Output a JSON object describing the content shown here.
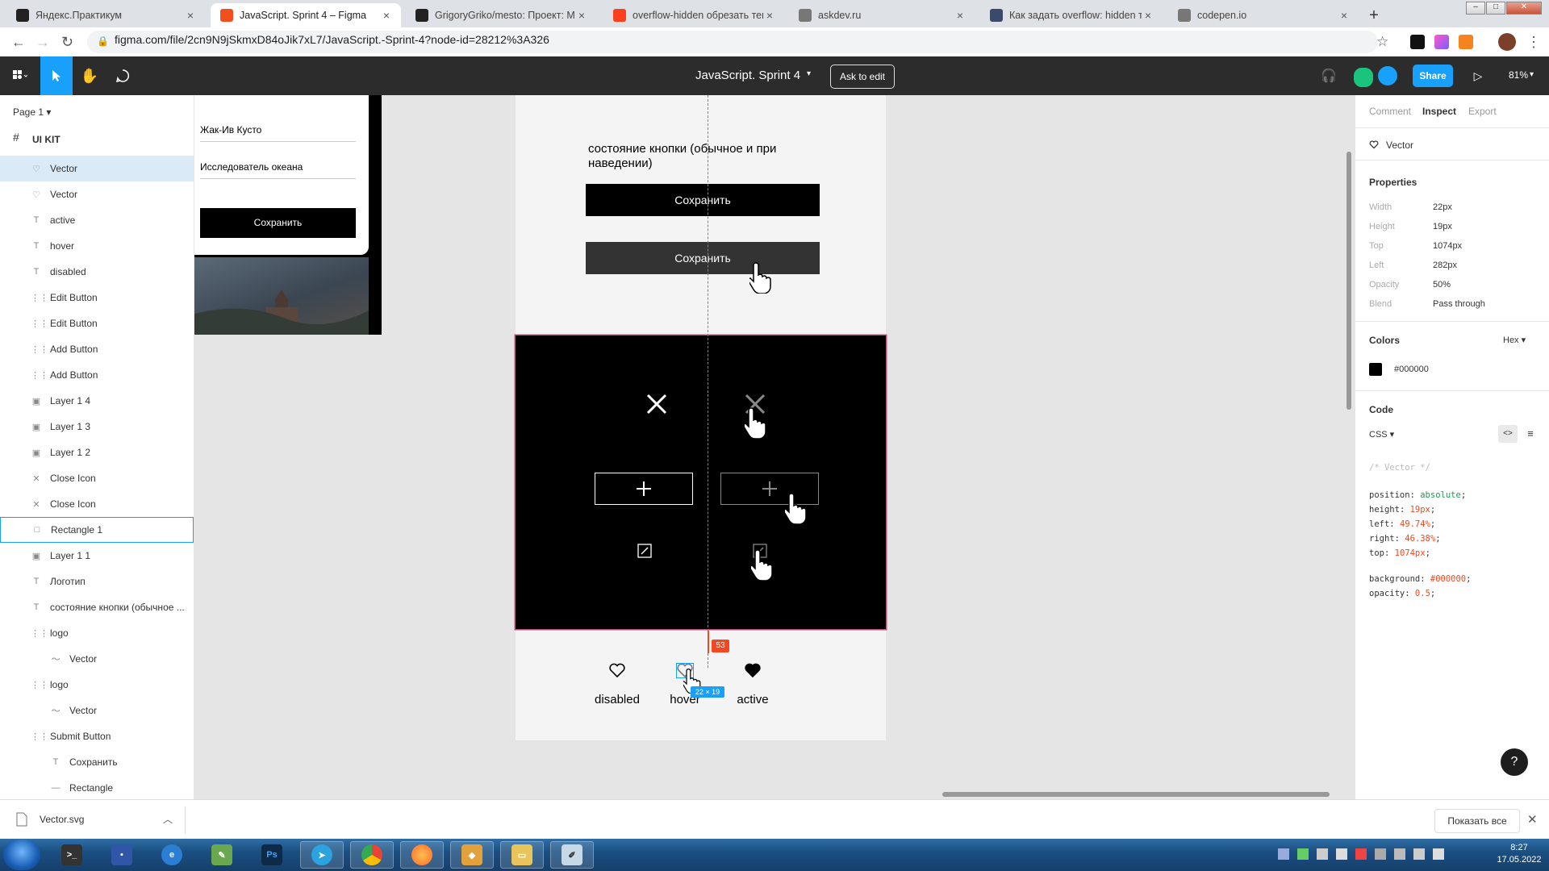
{
  "browser": {
    "tabs": [
      {
        "title": "Яндекс.Практикум",
        "favicon_color": "#222222"
      },
      {
        "title": "JavaScript. Sprint 4 – Figma",
        "favicon_color": "#f24e1e",
        "active": true
      },
      {
        "title": "GrigoryGriko/mesto: Проект: Ме",
        "favicon_color": "#222222"
      },
      {
        "title": "overflow-hidden обрезать текст",
        "favicon_color": "#fc3f1d"
      },
      {
        "title": "askdev.ru",
        "favicon_color": "#777777"
      },
      {
        "title": "Как задать overflow: hidden тол",
        "favicon_color": "#3b4a6b"
      },
      {
        "title": "codepen.io",
        "favicon_color": "#777777"
      }
    ],
    "url": "figma.com/file/2cn9N9jSkmxD84oJik7xL7/JavaScript.-Sprint-4?node-id=28212%3A326"
  },
  "figma": {
    "doc_title": "JavaScript. Sprint 4",
    "ask_to_edit": "Ask to edit",
    "share": "Share",
    "zoom": "81%"
  },
  "layers_panel": {
    "page": "Page 1",
    "frame": "UI KIT",
    "items": [
      {
        "name": "Vector",
        "icon": "heart-icon",
        "selected": true
      },
      {
        "name": "Vector",
        "icon": "heart-icon"
      },
      {
        "name": "active",
        "icon": "text-icon"
      },
      {
        "name": "hover",
        "icon": "text-icon"
      },
      {
        "name": "disabled",
        "icon": "text-icon"
      },
      {
        "name": "Edit Button",
        "icon": "group-icon"
      },
      {
        "name": "Edit Button",
        "icon": "group-icon"
      },
      {
        "name": "Add Button",
        "icon": "group-icon"
      },
      {
        "name": "Add Button",
        "icon": "group-icon"
      },
      {
        "name": "Layer 1 4",
        "icon": "image-icon"
      },
      {
        "name": "Layer 1 3",
        "icon": "image-icon"
      },
      {
        "name": "Layer 1 2",
        "icon": "image-icon"
      },
      {
        "name": "Close Icon",
        "icon": "close-icon"
      },
      {
        "name": "Close Icon",
        "icon": "close-icon"
      },
      {
        "name": "Rectangle 1",
        "icon": "rectangle-icon",
        "outlined": true
      },
      {
        "name": "Layer 1 1",
        "icon": "image-icon"
      },
      {
        "name": "Логотип",
        "icon": "text-icon"
      },
      {
        "name": "состояние кнопки (обычное ...",
        "icon": "text-icon"
      },
      {
        "name": "logo",
        "icon": "group-icon"
      },
      {
        "name": "Vector",
        "icon": "vector-icon",
        "indent": true
      },
      {
        "name": "logo",
        "icon": "group-icon"
      },
      {
        "name": "Vector",
        "icon": "vector-icon",
        "indent": true
      },
      {
        "name": "Submit Button",
        "icon": "group-icon"
      },
      {
        "name": "Сохранить",
        "icon": "text-icon",
        "indent": true
      },
      {
        "name": "Rectangle",
        "icon": "line-icon",
        "indent": true
      }
    ]
  },
  "canvas": {
    "card": {
      "name_value": "Жак-Ив Кусто",
      "about_value": "Исследователь океана",
      "save_label": "Сохранить"
    },
    "states_label": "состояние кнопки (обычное и при наведении)",
    "save_normal": "Сохранить",
    "save_hover": "Сохранить",
    "save_normal_color": "#000000",
    "save_hover_color": "#333333",
    "like_labels": {
      "disabled": "disabled",
      "hover": "hover",
      "active": "active"
    },
    "measure_distance": "53",
    "selection_dims": "22 × 19"
  },
  "inspect_panel": {
    "tabs": [
      "Comment",
      "Inspect",
      "Export"
    ],
    "active_tab": "Inspect",
    "selected_name": "Vector",
    "properties_title": "Properties",
    "properties": [
      {
        "key": "Width",
        "value": "22px"
      },
      {
        "key": "Height",
        "value": "19px"
      },
      {
        "key": "Top",
        "value": "1074px"
      },
      {
        "key": "Left",
        "value": "282px"
      },
      {
        "key": "Opacity",
        "value": "50%"
      },
      {
        "key": "Blend",
        "value": "Pass through"
      }
    ],
    "colors_title": "Colors",
    "color_format": "Hex",
    "color_value": "#000000",
    "code_title": "Code",
    "code_lang": "CSS",
    "code_comment": "/* Vector */",
    "code_lines": [
      {
        "prop": "position",
        "val": "absolute"
      },
      {
        "prop": "height",
        "val": "19px"
      },
      {
        "prop": "left",
        "val": "49.74%"
      },
      {
        "prop": "right",
        "val": "46.38%"
      },
      {
        "prop": "top",
        "val": "1074px"
      }
    ],
    "code_lines2": [
      {
        "prop": "background",
        "val": "#000000"
      },
      {
        "prop": "opacity",
        "val": "0.5"
      }
    ]
  },
  "download_bar": {
    "file": "Vector.svg",
    "show_all": "Показать все"
  },
  "taskbar": {
    "time": "8:27",
    "date": "17.05.2022"
  }
}
